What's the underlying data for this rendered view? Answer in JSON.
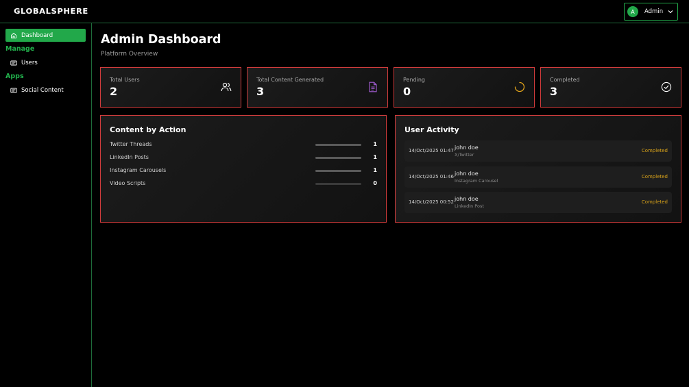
{
  "header": {
    "logo": "GLOBALSPHERE",
    "user": {
      "initial": "A",
      "name": "Admin"
    }
  },
  "sidebar": {
    "items": [
      {
        "label": "Dashboard",
        "icon": "home-icon",
        "active": true
      },
      {
        "label": "Users",
        "icon": "users-list-icon"
      },
      {
        "label": "Social Content",
        "icon": "content-list-icon"
      }
    ],
    "sections": {
      "manage": "Manage",
      "apps": "Apps"
    }
  },
  "main": {
    "title": "Admin Dashboard",
    "subtitle": "Platform Overview",
    "stats": [
      {
        "label": "Total Users",
        "value": "2",
        "icon": "users-icon"
      },
      {
        "label": "Total Content Generated",
        "value": "3",
        "icon": "document-icon"
      },
      {
        "label": "Pending",
        "value": "0",
        "icon": "spinner-icon"
      },
      {
        "label": "Completed",
        "value": "3",
        "icon": "check-circle-icon"
      }
    ],
    "content_by_action": {
      "title": "Content by Action",
      "rows": [
        {
          "label": "Twitter Threads",
          "count": "1"
        },
        {
          "label": "LinkedIn Posts",
          "count": "1"
        },
        {
          "label": "Instagram Carousels",
          "count": "1"
        },
        {
          "label": "Video Scripts",
          "count": "0"
        }
      ]
    },
    "user_activity": {
      "title": "User Activity",
      "items": [
        {
          "time": "14/Oct/2025 01:47",
          "user": "john doe",
          "type": "X/Twitter",
          "status": "Completed"
        },
        {
          "time": "14/Oct/2025 01:46",
          "user": "john doe",
          "type": "Instagram Carousel",
          "status": "Completed"
        },
        {
          "time": "14/Oct/2025 00:52",
          "user": "john doe",
          "type": "LinkedIn Post",
          "status": "Completed"
        }
      ]
    }
  },
  "colors": {
    "accent": "#22a84a",
    "card_border": "#d13c3c",
    "pending_icon": "#e0a21a",
    "document_icon": "#a55ed6",
    "status_completed": "#d9a31a"
  }
}
